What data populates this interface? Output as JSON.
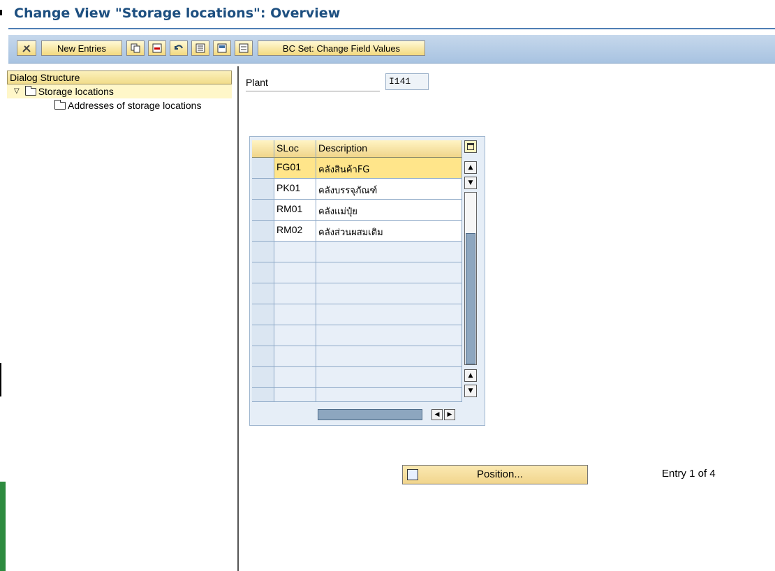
{
  "window": {
    "title": "Change View \"Storage locations\": Overview"
  },
  "toolbar": {
    "new_entries_label": "New Entries",
    "bc_set_label": "BC Set: Change Field Values",
    "icons": [
      "display-change-icon",
      "copy-icon",
      "delete-icon",
      "undo-icon",
      "select-all-icon",
      "select-block-icon",
      "deselect-all-icon"
    ]
  },
  "dialog_structure": {
    "header": "Dialog Structure",
    "items": [
      {
        "label": "Storage locations",
        "expanded": true
      },
      {
        "label": "Addresses of storage locations"
      }
    ]
  },
  "plant": {
    "label": "Plant",
    "value": "I141"
  },
  "table": {
    "columns": {
      "sloc": "SLoc",
      "description": "Description"
    },
    "rows": [
      {
        "sloc": "FG01",
        "description": "คลังสินค้าFG"
      },
      {
        "sloc": "PK01",
        "description": "คลังบรรจุภัณฑ์"
      },
      {
        "sloc": "RM01",
        "description": "คลังแม่ปุ๋ย"
      },
      {
        "sloc": "RM02",
        "description": "คลังส่วนผสมเติม"
      }
    ],
    "empty_rows": 8
  },
  "position": {
    "button_label": "Position...",
    "entry_text": "Entry 1 of 4"
  },
  "colors": {
    "title": "#1d4f80",
    "toolbar": "#b6cde6",
    "button": "#f3d97f",
    "selected_row": "#ffe58a"
  }
}
